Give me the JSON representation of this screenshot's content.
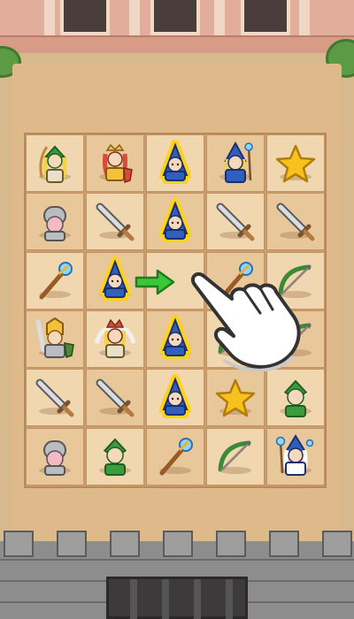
{
  "scene": {
    "title": "",
    "board": {
      "cols": 5,
      "rows": 6,
      "grid": [
        [
          "archer-elf-hero",
          "paladin-queen-hero",
          "blue-wizard",
          "blue-sorcerer-hero",
          "gold-star"
        ],
        [
          "knight-helmet",
          "iron-sword",
          "blue-wizard",
          "iron-sword",
          "iron-sword"
        ],
        [
          "magic-staff",
          "blue-wizard",
          "empty",
          "magic-staff",
          "bow-crossbow"
        ],
        [
          "warrior-knight-hero",
          "valkyrie-hero",
          "blue-wizard",
          "bow-crossbow",
          "bow-crossbow"
        ],
        [
          "iron-sword",
          "iron-sword",
          "blue-wizard",
          "gold-star",
          "elf-ranger"
        ],
        [
          "knight-helmet",
          "elf-ranger",
          "magic-staff",
          "bow-crossbow",
          "archmage-hero"
        ]
      ],
      "selected": [
        [
          0,
          2
        ],
        [
          1,
          2
        ],
        [
          2,
          1
        ],
        [
          3,
          2
        ],
        [
          4,
          2
        ]
      ]
    },
    "hint": {
      "arrow_icon": "green-arrow-right-icon",
      "hand_icon": "pointing-hand-icon"
    },
    "colors": {
      "selection_outline": "#ffd21a",
      "arrow": "#3cc63a",
      "wizard_robe": "#2f5fbf",
      "star": "#f7c21b"
    }
  }
}
